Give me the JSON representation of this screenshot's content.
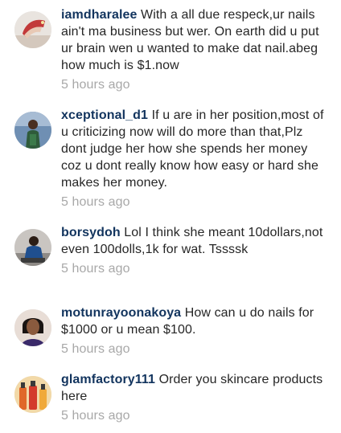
{
  "comments": [
    {
      "username": "iamdharalee",
      "text": "With a all due respeck,ur nails ain't ma business but wer. On earth did u put ur brain wen u wanted to make dat nail.abeg how much is $1.now",
      "time": "5 hours ago",
      "avatar_icon": "nail-photo-avatar"
    },
    {
      "username": "xceptional_d1",
      "text": "If u are in her position,most of u criticizing now will do more than that,Plz dont judge her how she spends her money coz u dont really know how easy or hard she makes her money.",
      "time": "5 hours ago",
      "avatar_icon": "person-photo-avatar"
    },
    {
      "username": "borsydoh",
      "text": "Lol I think she meant 10dollars,not even 100dolls,1k for wat. Tssssk",
      "time": "5 hours ago",
      "avatar_icon": "person-photo-avatar"
    },
    {
      "username": "motunrayoonakoya",
      "text": "How can u do nails for $1000 or u mean $100.",
      "time": "5 hours ago",
      "avatar_icon": "woman-photo-avatar"
    },
    {
      "username": "glamfactory111",
      "text": "Order you skincare products here",
      "time": "5 hours ago",
      "avatar_icon": "bottles-photo-avatar"
    }
  ]
}
